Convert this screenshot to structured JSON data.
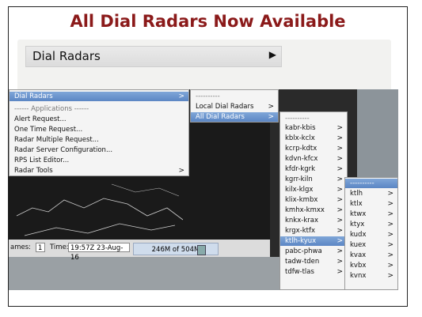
{
  "slide": {
    "title": "All Dial Radars Now Available"
  },
  "dial_bar": {
    "label": "Dial Radars",
    "arrow": "▶"
  },
  "main_menu": {
    "items": [
      {
        "label": "Dial Radars",
        "submenu": true,
        "selected": true
      },
      {
        "label": "------ Applications ------",
        "separator": true
      },
      {
        "label": "Alert Request..."
      },
      {
        "label": "One Time Request..."
      },
      {
        "label": "Radar Multiple Request..."
      },
      {
        "label": "Radar Server Configuration..."
      },
      {
        "label": "RPS List Editor..."
      },
      {
        "label": "Radar Tools",
        "submenu": true
      }
    ]
  },
  "dial_menu": {
    "items": [
      {
        "label": "----------",
        "separator": true
      },
      {
        "label": "Local Dial Radars",
        "submenu": true
      },
      {
        "label": "All Dial Radars",
        "submenu": true,
        "selected": true
      }
    ]
  },
  "all_menu": {
    "items": [
      {
        "label": "----------",
        "separator": true
      },
      {
        "label": "kabr-kbis"
      },
      {
        "label": "kblx-kclx"
      },
      {
        "label": "kcrp-kdtx"
      },
      {
        "label": "kdvn-kfcx"
      },
      {
        "label": "kfdr-kgrk"
      },
      {
        "label": "kgrr-kiln"
      },
      {
        "label": "kilx-klgx"
      },
      {
        "label": "klix-kmbx"
      },
      {
        "label": "kmhx-kmxx"
      },
      {
        "label": "knkx-krax"
      },
      {
        "label": "krgx-ktfx"
      },
      {
        "label": "ktlh-kyux",
        "selected": true
      },
      {
        "label": "pabc-phwa"
      },
      {
        "label": "tadw-tden"
      },
      {
        "label": "tdfw-tlas"
      }
    ]
  },
  "ktlh_menu": {
    "items": [
      {
        "label": "----------",
        "separator": true,
        "selected": true
      },
      {
        "label": "ktlh"
      },
      {
        "label": "ktlx"
      },
      {
        "label": "ktwx"
      },
      {
        "label": "ktyx"
      },
      {
        "label": "kudx"
      },
      {
        "label": "kuex"
      },
      {
        "label": "kvax"
      },
      {
        "label": "kvbx"
      },
      {
        "label": "kvnx"
      }
    ]
  },
  "status_bar": {
    "frames_label": "ames:",
    "frames_value": "1",
    "time_label": "Time:",
    "time_value": "19:57Z 23-Aug-16",
    "memory": "246M of 504M"
  },
  "colors": {
    "title": "#8b1a1a",
    "selection": "#5b86c4"
  }
}
